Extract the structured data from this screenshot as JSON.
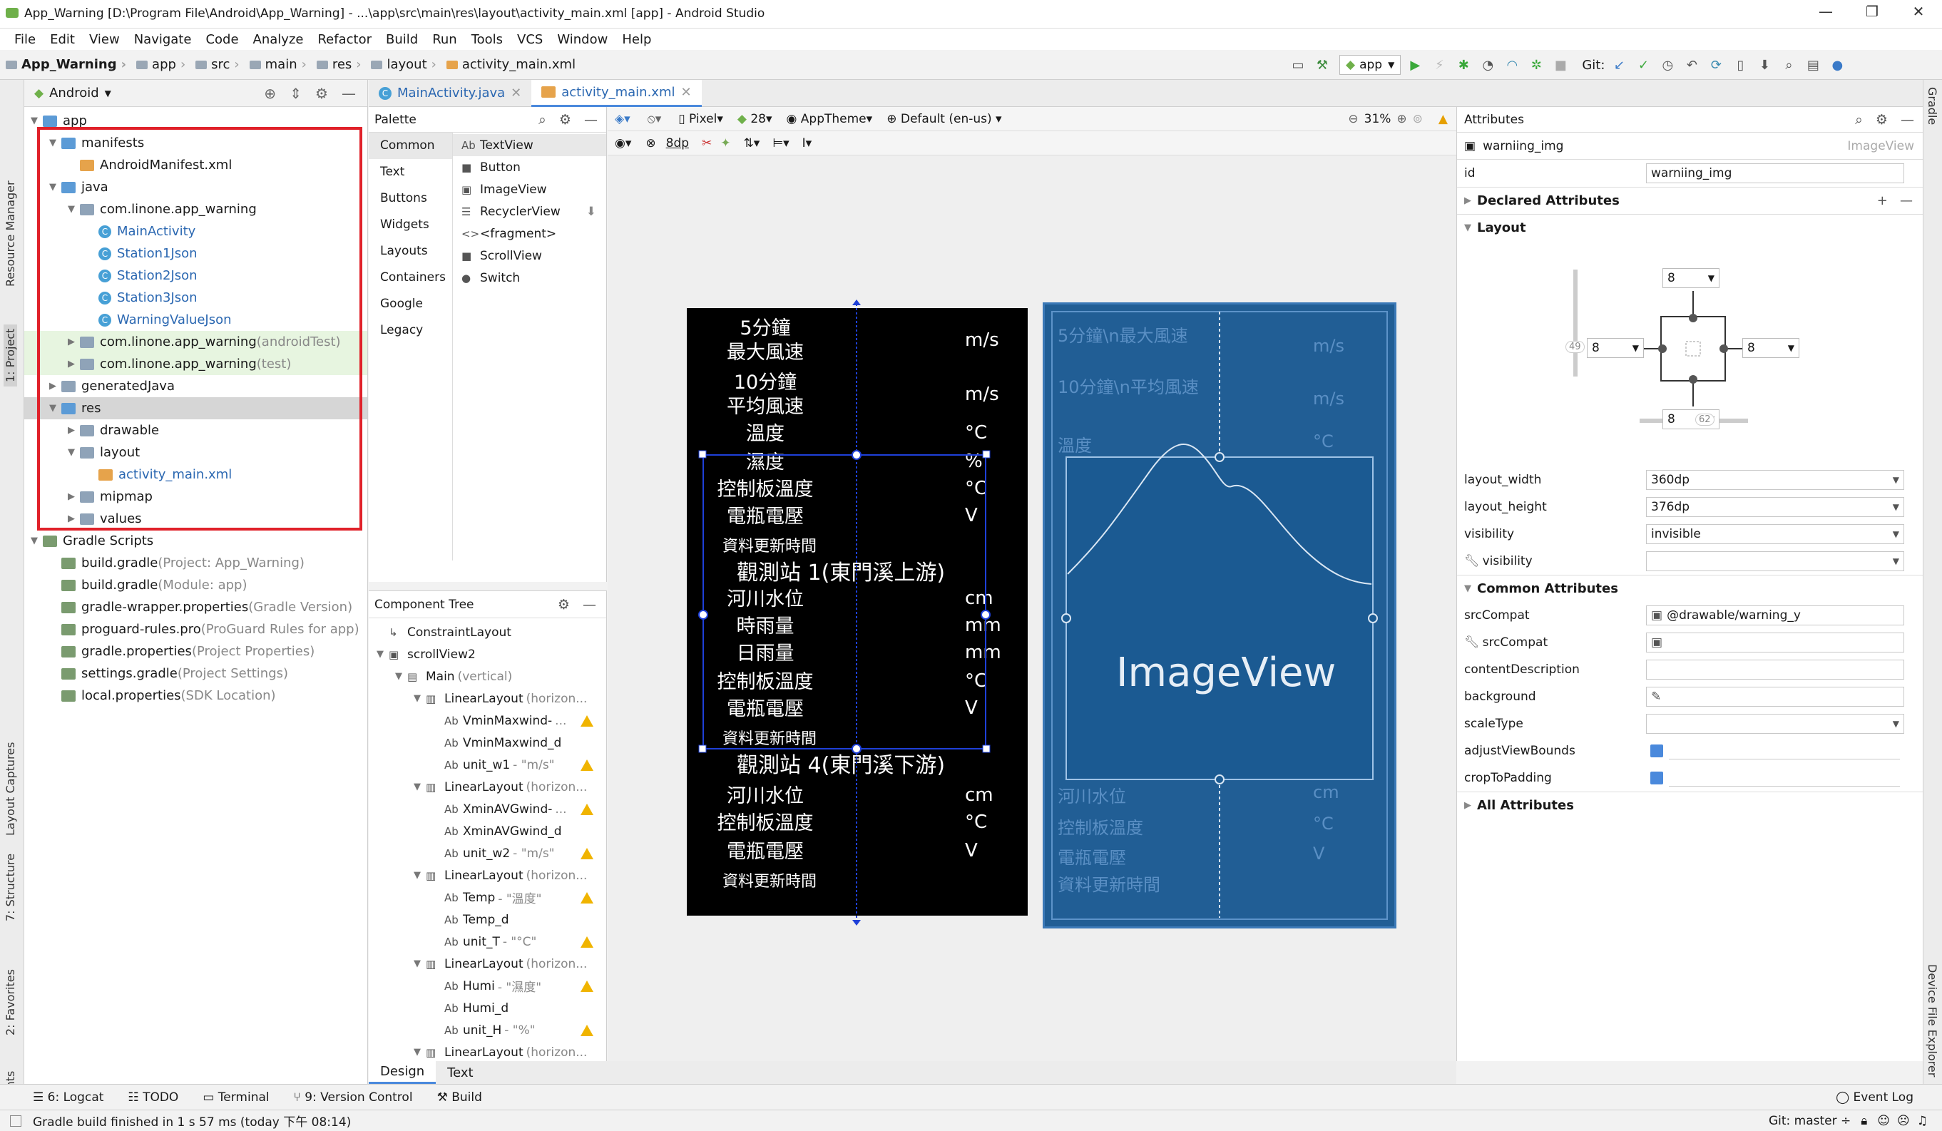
{
  "window": {
    "title": "App_Warning [D:\\Program File\\Android\\App_Warning] - ...\\app\\src\\main\\res\\layout\\activity_main.xml [app] - Android Studio"
  },
  "menu": [
    "File",
    "Edit",
    "View",
    "Navigate",
    "Code",
    "Analyze",
    "Refactor",
    "Build",
    "Run",
    "Tools",
    "VCS",
    "Window",
    "Help"
  ],
  "breadcrumb": [
    "App_Warning",
    "app",
    "src",
    "main",
    "res",
    "layout",
    "activity_main.xml"
  ],
  "toolbar": {
    "run_config": "app",
    "git_label": "Git:"
  },
  "left_strip": [
    "Resource Manager",
    "1: Project",
    "Layout Captures",
    "7: Structure",
    "2: Favorites",
    "Build Variants"
  ],
  "right_strip": [
    "Gradle",
    "Device File Explorer"
  ],
  "project": {
    "view": "Android",
    "tree": [
      {
        "label": "app",
        "depth": 0,
        "icon": "folder-icon",
        "arrow": "▼"
      },
      {
        "label": "manifests",
        "depth": 1,
        "icon": "folder-icon",
        "arrow": "▼"
      },
      {
        "label": "AndroidManifest.xml",
        "depth": 2,
        "icon": "xml-file-icon",
        "arrow": ""
      },
      {
        "label": "java",
        "depth": 1,
        "icon": "folder-icon",
        "arrow": "▼"
      },
      {
        "label": "com.linone.app_warning",
        "depth": 2,
        "icon": "package-icon",
        "arrow": "▼"
      },
      {
        "label": "MainActivity",
        "depth": 3,
        "icon": "class-icon",
        "arrow": "",
        "style": "blue"
      },
      {
        "label": "Station1Json",
        "depth": 3,
        "icon": "class-icon",
        "arrow": "",
        "style": "blue"
      },
      {
        "label": "Station2Json",
        "depth": 3,
        "icon": "class-icon",
        "arrow": "",
        "style": "blue"
      },
      {
        "label": "Station3Json",
        "depth": 3,
        "icon": "class-icon",
        "arrow": "",
        "style": "blue"
      },
      {
        "label": "WarningValueJson",
        "depth": 3,
        "icon": "class-icon",
        "arrow": "",
        "style": "blue"
      },
      {
        "label": "com.linone.app_warning",
        "suffix": " (androidTest)",
        "depth": 2,
        "icon": "package-icon",
        "arrow": "▶",
        "style": "green"
      },
      {
        "label": "com.linone.app_warning",
        "suffix": " (test)",
        "depth": 2,
        "icon": "package-icon",
        "arrow": "▶",
        "style": "green"
      },
      {
        "label": "generatedJava",
        "depth": 1,
        "icon": "folder-icon",
        "arrow": "▶"
      },
      {
        "label": "res",
        "depth": 1,
        "icon": "folder-icon",
        "arrow": "▼",
        "style": "sel"
      },
      {
        "label": "drawable",
        "depth": 2,
        "icon": "folder-icon",
        "arrow": "▶"
      },
      {
        "label": "layout",
        "depth": 2,
        "icon": "folder-icon",
        "arrow": "▼"
      },
      {
        "label": "activity_main.xml",
        "depth": 3,
        "icon": "xml-file-icon",
        "arrow": "",
        "style": "blue"
      },
      {
        "label": "mipmap",
        "depth": 2,
        "icon": "folder-icon",
        "arrow": "▶"
      },
      {
        "label": "values",
        "depth": 2,
        "icon": "folder-icon",
        "arrow": "▶"
      },
      {
        "label": "Gradle Scripts",
        "depth": 0,
        "icon": "gradle-icon",
        "arrow": "▼"
      },
      {
        "label": "build.gradle",
        "suffix": " (Project: App_Warning)",
        "depth": 1,
        "icon": "gradle-icon",
        "arrow": ""
      },
      {
        "label": "build.gradle",
        "suffix": " (Module: app)",
        "depth": 1,
        "icon": "gradle-icon",
        "arrow": ""
      },
      {
        "label": "gradle-wrapper.properties",
        "suffix": " (Gradle Version)",
        "depth": 1,
        "icon": "properties-icon",
        "arrow": ""
      },
      {
        "label": "proguard-rules.pro",
        "suffix": " (ProGuard Rules for app)",
        "depth": 1,
        "icon": "file-icon",
        "arrow": ""
      },
      {
        "label": "gradle.properties",
        "suffix": " (Project Properties)",
        "depth": 1,
        "icon": "properties-icon",
        "arrow": ""
      },
      {
        "label": "settings.gradle",
        "suffix": " (Project Settings)",
        "depth": 1,
        "icon": "gradle-icon",
        "arrow": ""
      },
      {
        "label": "local.properties",
        "suffix": " (SDK Location)",
        "depth": 1,
        "icon": "properties-icon",
        "arrow": ""
      }
    ]
  },
  "editor_tabs": [
    {
      "label": "MainActivity.java",
      "active": false
    },
    {
      "label": "activity_main.xml",
      "active": true
    }
  ],
  "palette": {
    "title": "Palette",
    "categories": [
      "Common",
      "Text",
      "Buttons",
      "Widgets",
      "Layouts",
      "Containers",
      "Google",
      "Legacy"
    ],
    "items": [
      {
        "label": "TextView",
        "icon": "Ab"
      },
      {
        "label": "Button",
        "icon": "■"
      },
      {
        "label": "ImageView",
        "icon": "▣"
      },
      {
        "label": "RecyclerView",
        "icon": "☰"
      },
      {
        "label": "<fragment>",
        "icon": "<>"
      },
      {
        "label": "ScrollView",
        "icon": "■"
      },
      {
        "label": "Switch",
        "icon": "●"
      }
    ]
  },
  "component_tree": {
    "title": "Component Tree",
    "nodes": [
      {
        "label": "ConstraintLayout",
        "depth": 0,
        "warn": false,
        "icon": "↳"
      },
      {
        "label": "scrollView2",
        "depth": 0,
        "warn": false,
        "icon": "▣",
        "arrow": "▼"
      },
      {
        "label": "Main",
        "suffix": "(vertical)",
        "depth": 1,
        "warn": false,
        "icon": "▤",
        "arrow": "▼"
      },
      {
        "label": "LinearLayout",
        "suffix": "(horizon...",
        "depth": 2,
        "warn": false,
        "icon": "▥",
        "arrow": "▼"
      },
      {
        "label": "VminMaxwind-",
        "suffix": "...",
        "depth": 3,
        "warn": true,
        "icon": "Ab"
      },
      {
        "label": "VminMaxwind_d",
        "depth": 3,
        "warn": false,
        "icon": "Ab"
      },
      {
        "label": "unit_w1",
        "suffix": "- \"m/s\"",
        "depth": 3,
        "warn": true,
        "icon": "Ab"
      },
      {
        "label": "LinearLayout",
        "suffix": "(horizon...",
        "depth": 2,
        "warn": false,
        "icon": "▥",
        "arrow": "▼"
      },
      {
        "label": "XminAVGwind-",
        "suffix": "...",
        "depth": 3,
        "warn": true,
        "icon": "Ab"
      },
      {
        "label": "XminAVGwind_d",
        "depth": 3,
        "warn": false,
        "icon": "Ab"
      },
      {
        "label": "unit_w2",
        "suffix": "- \"m/s\"",
        "depth": 3,
        "warn": true,
        "icon": "Ab"
      },
      {
        "label": "LinearLayout",
        "suffix": "(horizon...",
        "depth": 2,
        "warn": false,
        "icon": "▥",
        "arrow": "▼"
      },
      {
        "label": "Temp",
        "suffix": "- \"溫度\"",
        "depth": 3,
        "warn": true,
        "icon": "Ab"
      },
      {
        "label": "Temp_d",
        "depth": 3,
        "warn": false,
        "icon": "Ab"
      },
      {
        "label": "unit_T",
        "suffix": "- \"°C\"",
        "depth": 3,
        "warn": true,
        "icon": "Ab"
      },
      {
        "label": "LinearLayout",
        "suffix": "(horizon...",
        "depth": 2,
        "warn": false,
        "icon": "▥",
        "arrow": "▼"
      },
      {
        "label": "Humi",
        "suffix": "- \"濕度\"",
        "depth": 3,
        "warn": true,
        "icon": "Ab"
      },
      {
        "label": "Humi_d",
        "depth": 3,
        "warn": false,
        "icon": "Ab"
      },
      {
        "label": "unit_H",
        "suffix": "- \"%\"",
        "depth": 3,
        "warn": true,
        "icon": "Ab"
      },
      {
        "label": "LinearLayout",
        "suffix": "(horizon...",
        "depth": 2,
        "warn": false,
        "icon": "▥",
        "arrow": "▼"
      }
    ]
  },
  "design_toolbar": {
    "device": "Pixel",
    "api": "28",
    "theme": "AppTheme",
    "locale": "Default (en-us)",
    "zoom": "31%",
    "margin": "8dp"
  },
  "phone_preview": {
    "rows": [
      {
        "label": "5分鐘\n最大風速",
        "unit": "m/s"
      },
      {
        "label": "10分鐘\n平均風速",
        "unit": "m/s"
      },
      {
        "label": "溫度",
        "unit": "°C"
      },
      {
        "label": "濕度",
        "unit": "%"
      },
      {
        "label": "控制板溫度",
        "unit": "°C"
      },
      {
        "label": "電瓶電壓",
        "unit": "V"
      },
      {
        "label": "資料更新時間",
        "unit": ""
      },
      {
        "label": "觀測站 1(東門溪上游)",
        "unit": "",
        "header": true
      },
      {
        "label": "河川水位",
        "unit": "cm"
      },
      {
        "label": "時雨量",
        "unit": "mm"
      },
      {
        "label": "日雨量",
        "unit": "mm"
      },
      {
        "label": "控制板溫度",
        "unit": "°C"
      },
      {
        "label": "電瓶電壓",
        "unit": "V"
      },
      {
        "label": "資料更新時間",
        "unit": ""
      },
      {
        "label": "觀測站 4(東門溪下游)",
        "unit": "",
        "header": true
      },
      {
        "label": "河川水位",
        "unit": "cm"
      },
      {
        "label": "控制板溫度",
        "unit": "°C"
      },
      {
        "label": "電瓶電壓",
        "unit": "V"
      },
      {
        "label": "資料更新時間",
        "unit": ""
      }
    ]
  },
  "blueprint": {
    "imageview_label": "ImageView",
    "ghost_rows": [
      "5分鐘\\n最大風速",
      "10分鐘\\n平均風速",
      "溫度",
      "河川水位",
      "控制板溫度",
      "電瓶電壓",
      "資料更新時間"
    ],
    "ghost_units": [
      "m/s",
      "m/s",
      "°C",
      "cm",
      "°C",
      "V"
    ]
  },
  "attributes": {
    "title": "Attributes",
    "component": "warniing_img",
    "component_type": "ImageView",
    "id_label": "id",
    "id_value": "warniing_img",
    "declared": "Declared Attributes",
    "layout_section": "Layout",
    "constraint": {
      "top": "8",
      "left": "8",
      "right": "8",
      "bottom": "8",
      "bias_v": "49",
      "bias_h": "62"
    },
    "layout_rows": [
      {
        "k": "layout_width",
        "v": "360dp",
        "dd": true
      },
      {
        "k": "layout_height",
        "v": "376dp",
        "dd": true
      },
      {
        "k": "visibility",
        "v": "invisible",
        "dd": true
      },
      {
        "k": "visibility",
        "v": "",
        "dd": true,
        "tool": true
      }
    ],
    "common_section": "Common Attributes",
    "common_rows": [
      {
        "k": "srcCompat",
        "v": "@drawable/warning_y"
      },
      {
        "k": "srcCompat",
        "v": "",
        "tool": true
      },
      {
        "k": "contentDescription",
        "v": ""
      },
      {
        "k": "background",
        "v": ""
      },
      {
        "k": "scaleType",
        "v": "",
        "dd": true
      },
      {
        "k": "adjustViewBounds",
        "v": "",
        "check": true
      },
      {
        "k": "cropToPadding",
        "v": "",
        "check": true
      }
    ],
    "all": "All Attributes"
  },
  "design_tabs": [
    "Design",
    "Text"
  ],
  "tool_windows": [
    "6: Logcat",
    "TODO",
    "Terminal",
    "9: Version Control",
    "Build"
  ],
  "event_log": "Event Log",
  "status": {
    "message": "Gradle build finished in 1 s 57 ms (today 下午 08:14)",
    "git": "Git: master ÷"
  }
}
